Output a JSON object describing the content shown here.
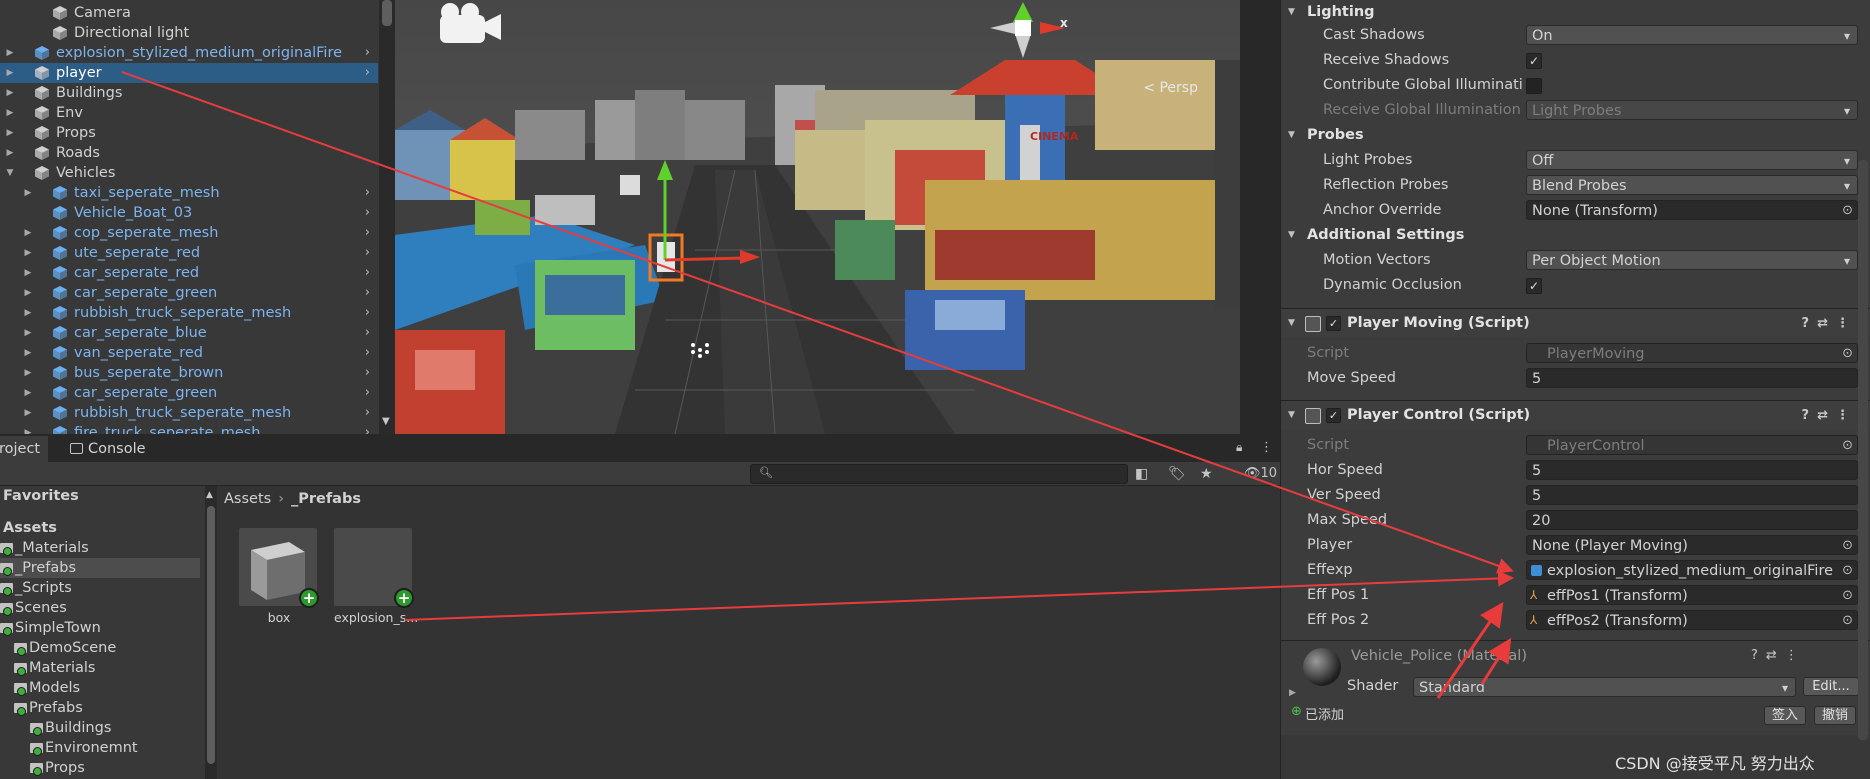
{
  "hierarchy": {
    "items": [
      {
        "label": "Camera",
        "indent": 1,
        "expand": "",
        "prefab": false,
        "more": false
      },
      {
        "label": "Directional light",
        "indent": 1,
        "expand": "",
        "prefab": false,
        "more": false
      },
      {
        "label": "explosion_stylized_medium_originalFire",
        "indent": 0,
        "expand": "▶",
        "prefab": true,
        "more": true
      },
      {
        "label": "player",
        "indent": 0,
        "expand": "▶",
        "prefab": false,
        "more": true,
        "selected": true
      },
      {
        "label": "Buildings",
        "indent": 0,
        "expand": "▶",
        "prefab": false,
        "more": false
      },
      {
        "label": "Env",
        "indent": 0,
        "expand": "▶",
        "prefab": false,
        "more": false
      },
      {
        "label": "Props",
        "indent": 0,
        "expand": "▶",
        "prefab": false,
        "more": false
      },
      {
        "label": "Roads",
        "indent": 0,
        "expand": "▶",
        "prefab": false,
        "more": false
      },
      {
        "label": "Vehicles",
        "indent": 0,
        "expand": "▼",
        "prefab": false,
        "more": false
      },
      {
        "label": "taxi_seperate_mesh",
        "indent": 1,
        "expand": "▶",
        "prefab": true,
        "more": true
      },
      {
        "label": "Vehicle_Boat_03",
        "indent": 1,
        "expand": "",
        "prefab": true,
        "more": true
      },
      {
        "label": "cop_seperate_mesh",
        "indent": 1,
        "expand": "▶",
        "prefab": true,
        "more": true
      },
      {
        "label": "ute_seperate_red",
        "indent": 1,
        "expand": "▶",
        "prefab": true,
        "more": true
      },
      {
        "label": "car_seperate_red",
        "indent": 1,
        "expand": "▶",
        "prefab": true,
        "more": true
      },
      {
        "label": "car_seperate_green",
        "indent": 1,
        "expand": "▶",
        "prefab": true,
        "more": true
      },
      {
        "label": "rubbish_truck_seperate_mesh",
        "indent": 1,
        "expand": "▶",
        "prefab": true,
        "more": true
      },
      {
        "label": "car_seperate_blue",
        "indent": 1,
        "expand": "▶",
        "prefab": true,
        "more": true
      },
      {
        "label": "van_seperate_red",
        "indent": 1,
        "expand": "▶",
        "prefab": true,
        "more": true
      },
      {
        "label": "bus_seperate_brown",
        "indent": 1,
        "expand": "▶",
        "prefab": true,
        "more": true
      },
      {
        "label": "car_seperate_green",
        "indent": 1,
        "expand": "▶",
        "prefab": true,
        "more": true
      },
      {
        "label": "rubbish_truck_seperate_mesh",
        "indent": 1,
        "expand": "▶",
        "prefab": true,
        "more": true
      },
      {
        "label": "fire_truck_seperate_mesh",
        "indent": 1,
        "expand": "▶",
        "prefab": true,
        "more": true
      }
    ]
  },
  "scene": {
    "persp_label": "< Persp",
    "gizmo_x_label": "x",
    "billboard_label": "CINEMA",
    "colors": {
      "sky": "#4b4b4b",
      "road": "#3d3d3d",
      "water": "#2f7fbf",
      "accent_red": "#d53b2a"
    }
  },
  "bottom": {
    "tabs": [
      {
        "label": "Project",
        "visible_text": "roject",
        "icon": "folder-icon"
      },
      {
        "label": "Console",
        "icon": "console-icon"
      }
    ],
    "filter_count": "10",
    "breadcrumb": [
      "Assets",
      "_Prefabs"
    ],
    "tree": [
      {
        "label": "Favorites",
        "header": true,
        "star": true
      },
      {
        "label": "Assets",
        "header": true
      },
      {
        "label": "_Materials",
        "indent": 0
      },
      {
        "label": "_Prefabs",
        "indent": 0,
        "selected": true
      },
      {
        "label": "_Scripts",
        "indent": 0
      },
      {
        "label": "Scenes",
        "indent": 0
      },
      {
        "label": "SimpleTown",
        "indent": 0
      },
      {
        "label": "DemoScene",
        "indent": 1
      },
      {
        "label": "Materials",
        "indent": 1
      },
      {
        "label": "Models",
        "indent": 1
      },
      {
        "label": "Prefabs",
        "indent": 1,
        "open": true
      },
      {
        "label": "Buildings",
        "indent": 2
      },
      {
        "label": "Environemnt",
        "indent": 2
      },
      {
        "label": "Props",
        "indent": 2
      }
    ],
    "assets": [
      {
        "name": "box",
        "thumb": "cube"
      },
      {
        "name": "explosion_s...",
        "thumb": "blank"
      }
    ]
  },
  "inspector": {
    "lighting": {
      "title": "Lighting",
      "cast_shadows_label": "Cast Shadows",
      "cast_shadows_value": "On",
      "receive_shadows_label": "Receive Shadows",
      "receive_shadows_checked": true,
      "contribute_gi_label": "Contribute Global Illuminatic",
      "contribute_gi_checked": false,
      "receive_gi_label": "Receive Global Illumination",
      "receive_gi_value": "Light Probes"
    },
    "probes": {
      "title": "Probes",
      "light_probes_label": "Light Probes",
      "light_probes_value": "Off",
      "reflection_probes_label": "Reflection Probes",
      "reflection_probes_value": "Blend Probes",
      "anchor_override_label": "Anchor Override",
      "anchor_override_value": "None (Transform)"
    },
    "additional": {
      "title": "Additional Settings",
      "motion_vectors_label": "Motion Vectors",
      "motion_vectors_value": "Per Object Motion",
      "dynamic_occlusion_label": "Dynamic Occlusion",
      "dynamic_occlusion_checked": true
    },
    "player_moving": {
      "title": "Player Moving (Script)",
      "script_label": "Script",
      "script_value": "PlayerMoving",
      "move_speed_label": "Move Speed",
      "move_speed_value": "5"
    },
    "player_control": {
      "title": "Player Control (Script)",
      "script_label": "Script",
      "script_value": "PlayerControl",
      "hor_speed_label": "Hor Speed",
      "hor_speed_value": "5",
      "ver_speed_label": "Ver Speed",
      "ver_speed_value": "5",
      "max_speed_label": "Max Speed",
      "max_speed_value": "20",
      "player_label": "Player",
      "player_value": "None (Player Moving)",
      "effexp_label": "Effexp",
      "effexp_value": "explosion_stylized_medium_originalFire",
      "effpos1_label": "Eff Pos 1",
      "effpos1_value": "effPos1 (Transform)",
      "effpos2_label": "Eff Pos 2",
      "effpos2_value": "effPos2 (Transform)"
    },
    "material": {
      "title": "Vehicle_Police (Material)",
      "shader_label": "Shader",
      "shader_value": "Standard",
      "edit_button": "Edit...",
      "added_label": "已添加",
      "checkin_button": "签入",
      "revert_button": "撤销"
    },
    "tool_icons": [
      "help-icon",
      "preset-icon",
      "more-icon"
    ]
  },
  "watermark": "CSDN @接受平凡 努力出众",
  "colors": {
    "selection": "#2c5d87",
    "prefab_text": "#7cb4f0",
    "arrow": "#e83c3c",
    "panel": "#383838",
    "inspector": "#3c3c3c"
  }
}
